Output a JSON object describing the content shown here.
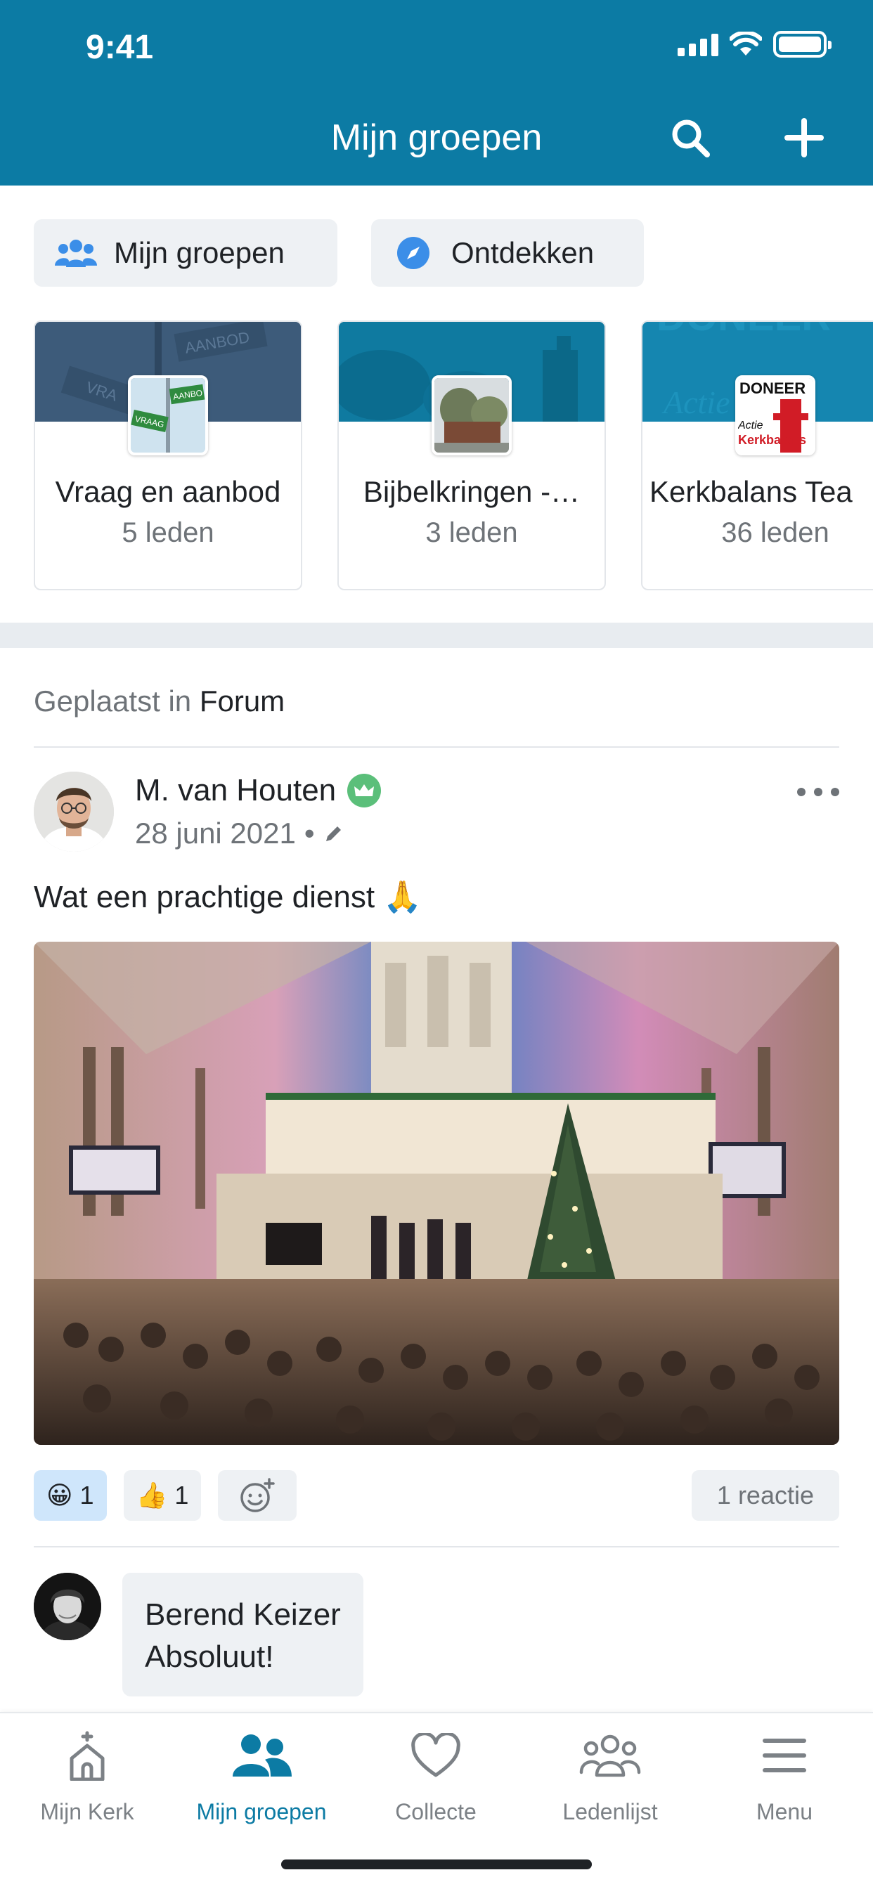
{
  "status_bar": {
    "time": "9:41"
  },
  "header": {
    "title": "Mijn groepen"
  },
  "segments": [
    {
      "label": "Mijn groepen",
      "icon": "users-icon"
    },
    {
      "label": "Ontdekken",
      "icon": "compass-icon"
    }
  ],
  "groups": [
    {
      "name": "Vraag en aanbod",
      "members": "5 leden"
    },
    {
      "name": "Bijbelkringen -…",
      "members": "3 leden"
    },
    {
      "name": "Kerkbalans Tea",
      "members": "36 leden"
    }
  ],
  "group_thumb_text": {
    "vraag_banner": "AANBOD",
    "vraag_banner_2": "VRA",
    "vraag_thumb_a": "AANBO",
    "vraag_thumb_b": "VRAAG",
    "kerkbalans_banner_a": "DONEER",
    "kerkbalans_banner_b": "Actie",
    "kerkbalans_thumb_a": "DONEER",
    "kerkbalans_thumb_b": "Actie",
    "kerkbalans_thumb_c": "Kerkbalans"
  },
  "post": {
    "posted_in_prefix": "Geplaatst in",
    "posted_in_group": "Forum",
    "author": "M. van Houten",
    "date": "28 juni 2021",
    "date_separator": "•",
    "text": "Wat een prachtige dienst 🙏",
    "reactions": [
      {
        "emoji": "😀",
        "count": "1",
        "active": true
      },
      {
        "emoji": "👍",
        "count": "1",
        "active": false
      }
    ],
    "reply_count": "1 reactie"
  },
  "comment": {
    "author": "Berend Keizer",
    "text": "Absoluut!"
  },
  "tabbar": [
    {
      "label": "Mijn Kerk",
      "icon": "church-icon",
      "active": false
    },
    {
      "label": "Mijn groepen",
      "icon": "groups-icon",
      "active": true
    },
    {
      "label": "Collecte",
      "icon": "heart-icon",
      "active": false
    },
    {
      "label": "Ledenlijst",
      "icon": "members-icon",
      "active": false
    },
    {
      "label": "Menu",
      "icon": "menu-icon",
      "active": false
    }
  ],
  "colors": {
    "brand": "#0c7ba4",
    "active_reaction": "#cfe6fb",
    "crown_badge": "#5bbf7a",
    "compass": "#3b8ee8"
  }
}
